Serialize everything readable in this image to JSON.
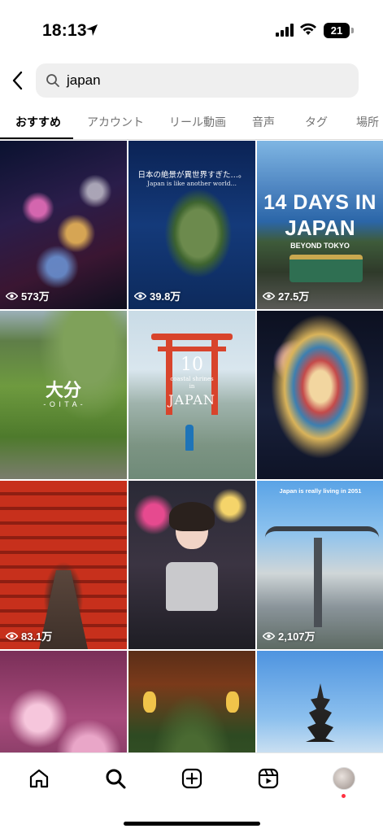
{
  "status_bar": {
    "time": "18:13",
    "battery": "21"
  },
  "search": {
    "query": "japan"
  },
  "tabs": [
    {
      "label": "おすすめ"
    },
    {
      "label": "アカウント"
    },
    {
      "label": "リール動画"
    },
    {
      "label": "音声"
    },
    {
      "label": "タグ"
    },
    {
      "label": "場所"
    }
  ],
  "grid": {
    "tiles": [
      {
        "views": "573万"
      },
      {
        "views": "39.8万",
        "caption_jp": "日本の絶景が異世界すぎた…。",
        "caption_en": "Japan is like another world…"
      },
      {
        "views": "27.5万",
        "title_line1": "14 DAYS IN",
        "title_line2": "JAPAN",
        "subtitle": "BEYOND TOKYO"
      },
      {
        "views": "",
        "title": "大分",
        "subtitle": "- O I T A -"
      },
      {
        "views": "",
        "number": "10",
        "small": "coastal shrines",
        "small2": "in",
        "big": "JAPAN"
      },
      {
        "views": ""
      },
      {
        "views": "83.1万"
      },
      {
        "views": ""
      },
      {
        "views": "2,107万",
        "caption": "Japan is really living in 2051"
      },
      {
        "views": ""
      },
      {
        "views": ""
      },
      {
        "views": ""
      }
    ]
  },
  "colors": {
    "accent_notification": "#ff3040",
    "tab_inactive": "#737373"
  }
}
